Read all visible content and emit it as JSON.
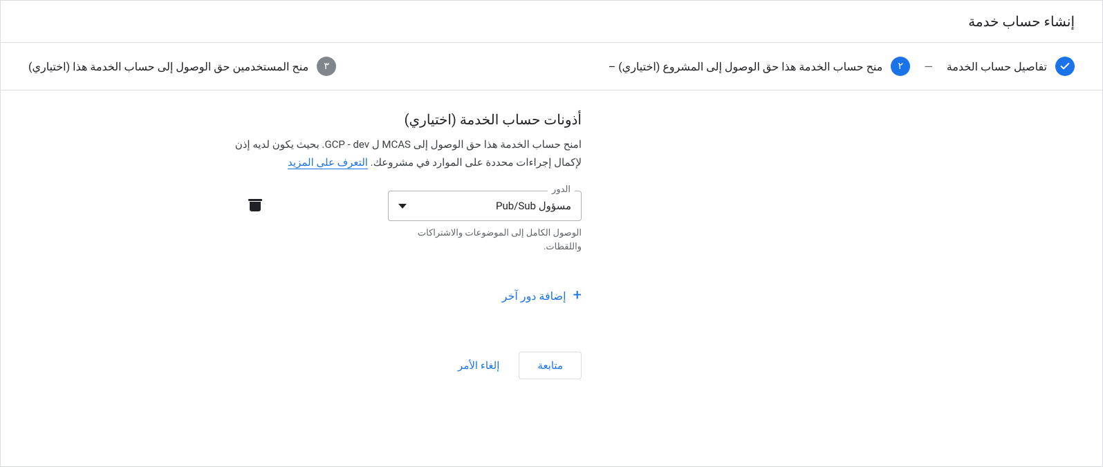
{
  "header": {
    "title": "إنشاء حساب خدمة"
  },
  "stepper": {
    "step1": {
      "label": "تفاصيل حساب الخدمة"
    },
    "step2": {
      "num": "٢",
      "label": "منح حساب الخدمة هذا حق الوصول إلى المشروع (اختياري) –"
    },
    "step3": {
      "num": "٣",
      "label": "منح المستخدمين حق الوصول إلى حساب الخدمة هذا (اختياري)"
    }
  },
  "section": {
    "title": "أذونات حساب الخدمة (اختياري)",
    "desc_prefix": "امنح حساب الخدمة هذا حق الوصول إلى MCAS ل GCP - dev. بحيث يكون لديه إذن لإكمال إجراءات محددة على الموارد في مشروعك. ",
    "learn_more": "التعرف على المزيد"
  },
  "role": {
    "field_label": "الدور",
    "value": "مسؤول Pub/Sub",
    "help": "الوصول الكامل إلى الموضوعات والاشتراكات واللقطات."
  },
  "add_role": {
    "label": "إضافة دور آخر"
  },
  "actions": {
    "continue": "متابعة",
    "cancel": "إلغاء الأمر"
  }
}
